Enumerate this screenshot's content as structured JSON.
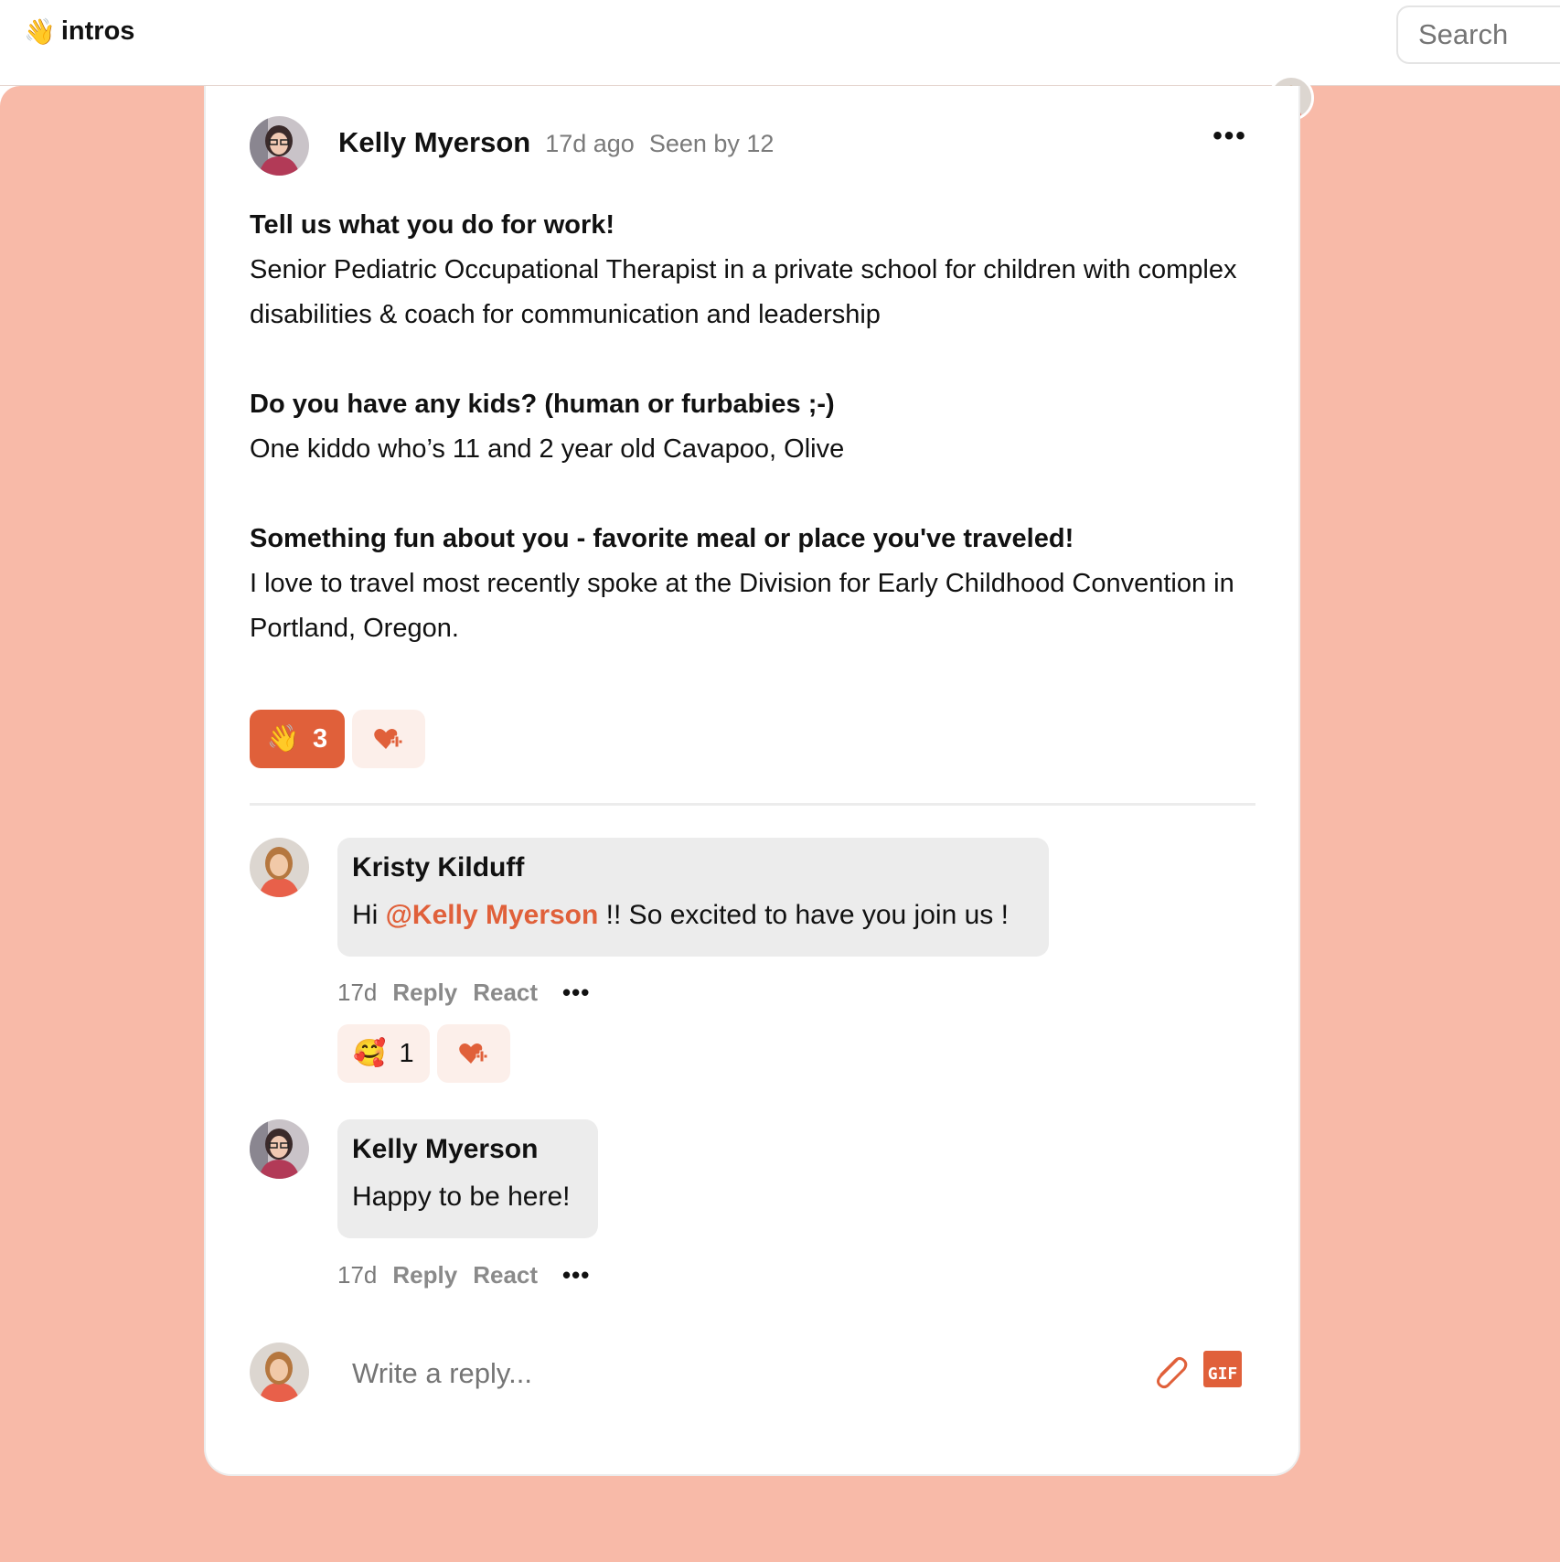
{
  "header": {
    "channel_emoji": "👋",
    "channel_name": "intros",
    "search_placeholder": "Search"
  },
  "post": {
    "author": "Kelly Myerson",
    "time": "17d ago",
    "seen": "Seen by 12",
    "more_label": "•••",
    "sections": [
      {
        "question": "Tell us what you do for work!",
        "answer": "Senior Pediatric Occupational Therapist in a private school for children with complex disabilities & coach for communication and leadership"
      },
      {
        "question": "Do you have any kids? (human or furbabies ;-)",
        "answer": "One kiddo who’s 11 and 2 year old Cavapoo, Olive"
      },
      {
        "question": "Something fun about you - favorite meal or place you've traveled!",
        "answer": "I love to travel most recently spoke at the Division for Early Childhood Convention in Portland, Oregon."
      }
    ],
    "reaction": {
      "emoji": "👋",
      "count": "3"
    }
  },
  "comments": [
    {
      "author": "Kristy Kilduff",
      "text_before": "Hi ",
      "mention": "@Kelly Myerson",
      "text_after": " !! So excited to have you join us !",
      "time": "17d",
      "reply_label": "Reply",
      "react_label": "React",
      "more_label": "•••",
      "reaction": {
        "emoji": "🥰",
        "count": "1"
      }
    },
    {
      "author": "Kelly Myerson",
      "text": "Happy to be here!",
      "time": "17d",
      "reply_label": "Reply",
      "react_label": "React",
      "more_label": "•••"
    }
  ],
  "composer": {
    "placeholder": "Write a reply...",
    "gif_label": "GIF"
  },
  "colors": {
    "accent": "#e0603a",
    "backdrop": "#f8baa8",
    "bubble": "#ececec"
  }
}
